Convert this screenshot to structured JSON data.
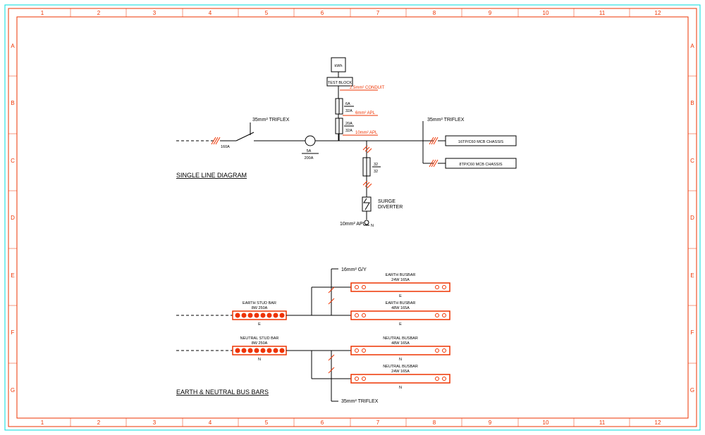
{
  "grid_cols": [
    "1",
    "2",
    "3",
    "4",
    "5",
    "6",
    "7",
    "8",
    "9",
    "10",
    "11",
    "12"
  ],
  "grid_rows": [
    "A",
    "B",
    "C",
    "D",
    "E",
    "F",
    "G"
  ],
  "sld": {
    "title": "SINGLE LINE DIAGRAM",
    "incoming_rating": "160A",
    "incoming_cable": "35mm² TRIFLEX",
    "ct": {
      "primary": "5A",
      "secondary": "200A"
    },
    "meter": "kWh",
    "test_block": "TEST BLOCK",
    "conduit": "2.5mm² CONDUIT",
    "fuse_top": {
      "rating": "6A",
      "frame": "32A"
    },
    "fuse_mid_cable": "6mm² APL",
    "fuse_mid": {
      "rating": "20A",
      "frame": "32A"
    },
    "fuse_bot_cable": "10mm² APL",
    "fuse_surge": {
      "rating": "32",
      "frame": "32"
    },
    "surge_cable": "10mm² APL",
    "surge_label": "SURGE\nDIVERTER",
    "outgoing_cable": "35mm² TRIFLEX",
    "chassis1": "16TP/C60 MCB CHASSIS",
    "chassis2": "8TP/C60 MCB CHASSIS"
  },
  "busbars": {
    "title": "EARTH & NEUTRAL BUS BARS",
    "gy_cable": "16mm² G/Y",
    "triflex": "35mm² TRIFLEX",
    "earth_stud": {
      "name": "EARTH STUD BAR",
      "rating": "8W 250A"
    },
    "neutral_stud": {
      "name": "NEUTRAL STUD BAR",
      "rating": "8W 250A"
    },
    "earth_bars": [
      {
        "name": "EARTH BUSBAR",
        "rating": "24W 165A"
      },
      {
        "name": "EARTH BUSBAR",
        "rating": "48W 165A"
      }
    ],
    "neutral_bars": [
      {
        "name": "NEUTRAL BUSBAR",
        "rating": "48W 165A"
      },
      {
        "name": "NEUTRAL BUSBAR",
        "rating": "24W 165A"
      }
    ],
    "E": "E",
    "N": "N"
  }
}
